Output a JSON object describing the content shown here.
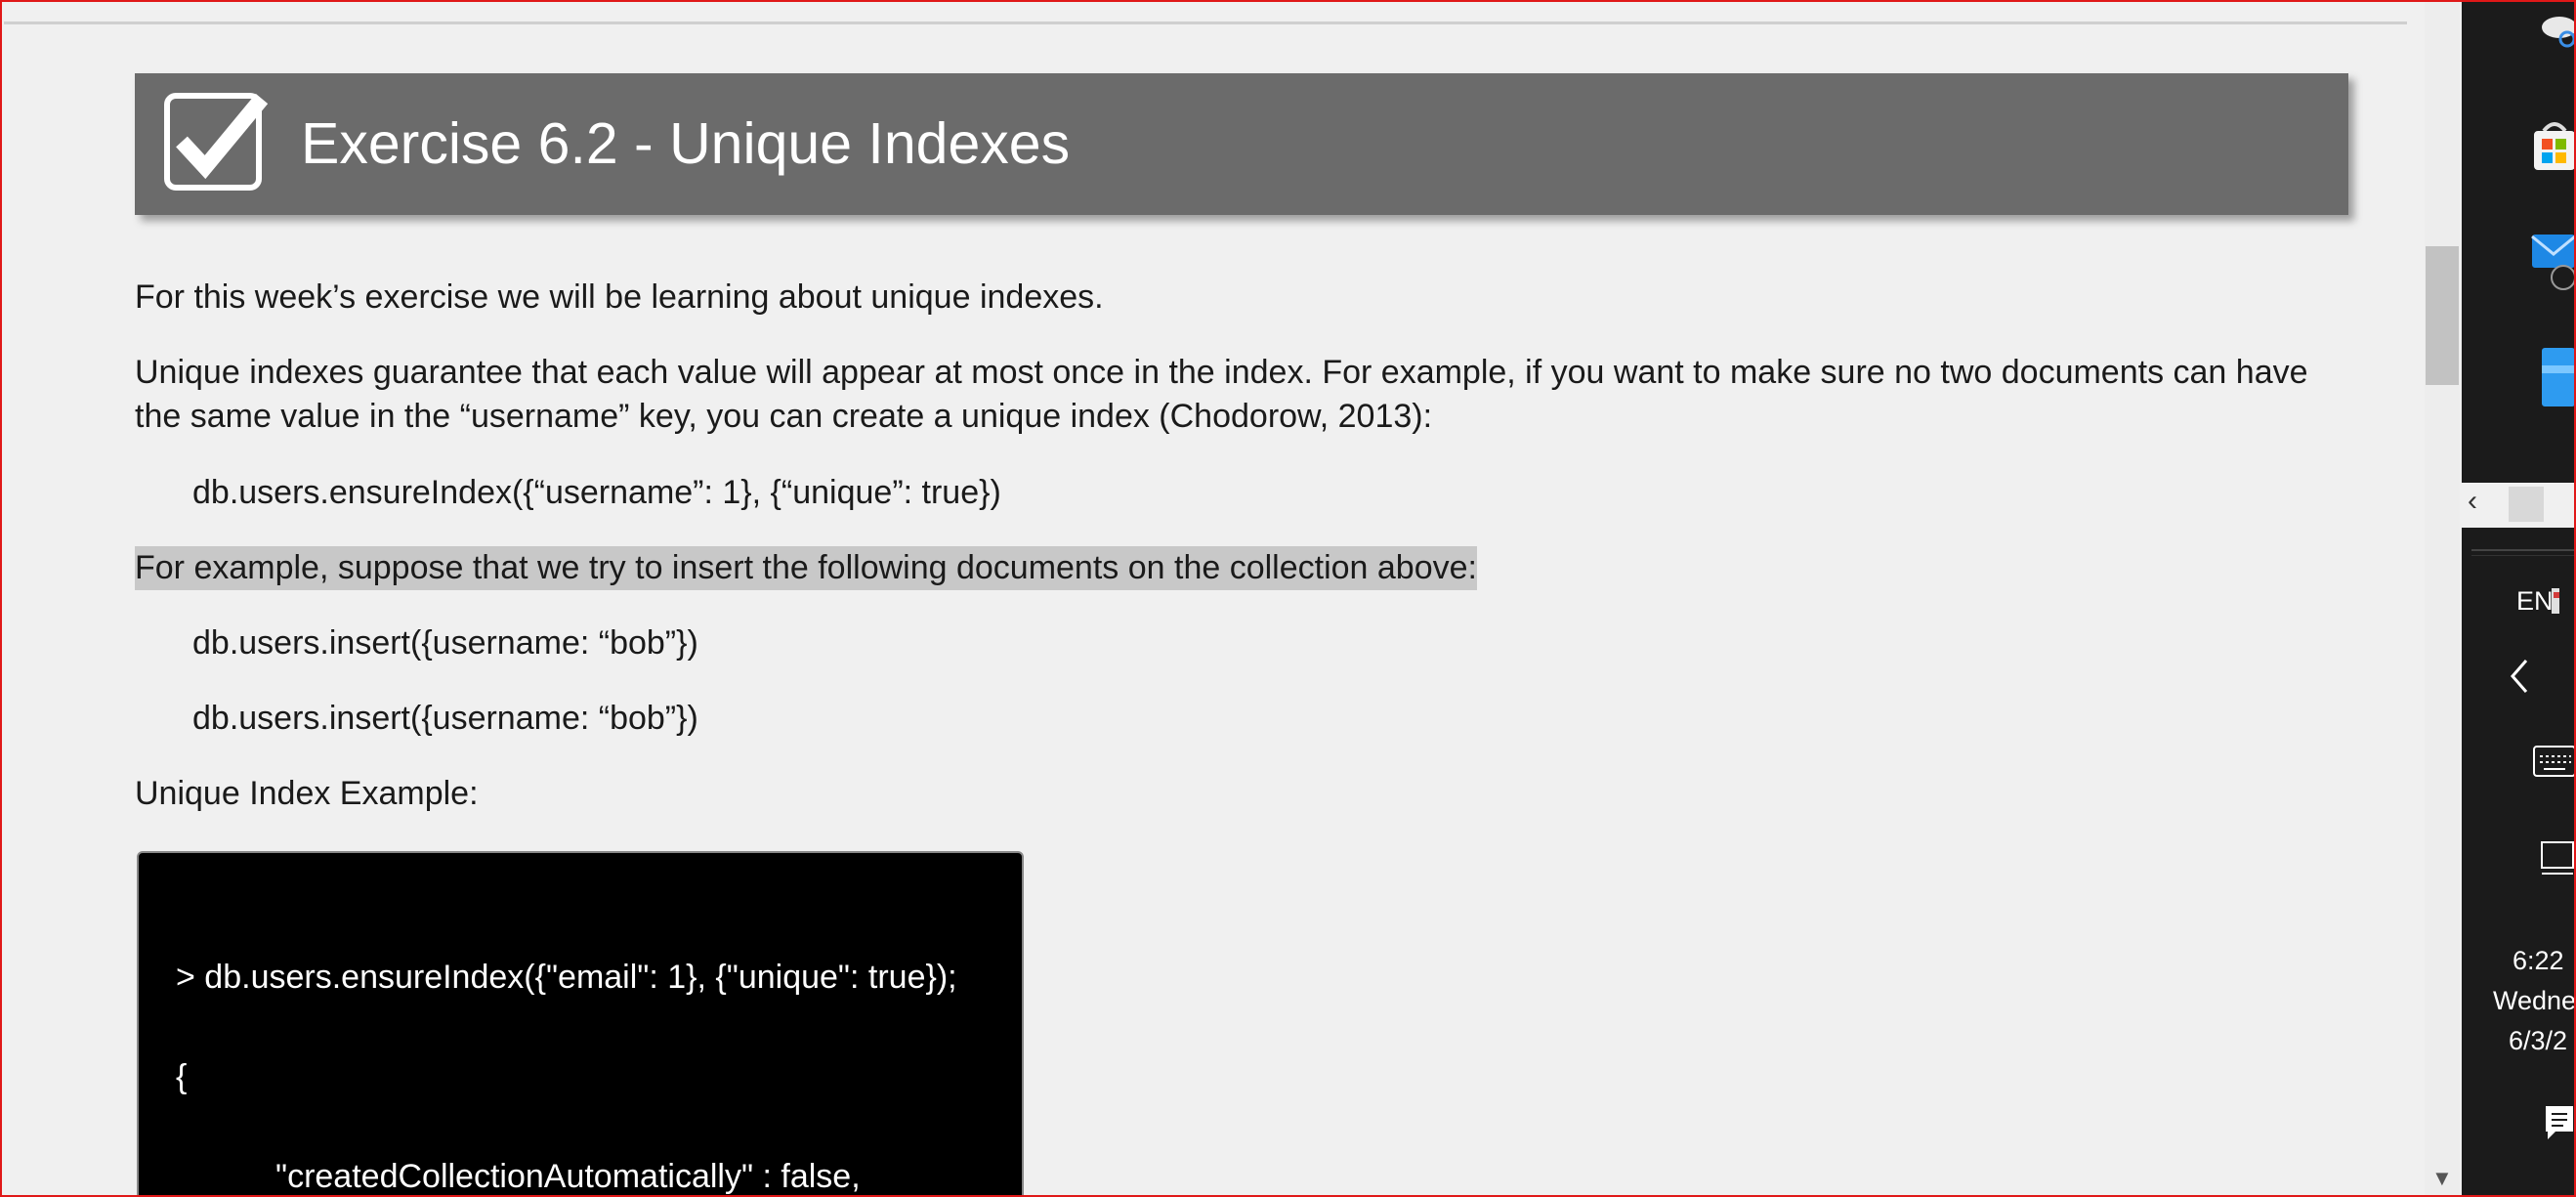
{
  "document": {
    "heading": "Exercise 6.2 - Unique Indexes",
    "paragraphs": {
      "intro": "For this week’s exercise we will be learning about unique indexes.",
      "definition": "Unique indexes guarantee that each value will appear at most once in the index. For example, if you want to make sure no two documents can have the same value in the “username” key, you can create a unique index (Chodorow, 2013):",
      "example_intro": "For example, suppose that we try to insert the following documents on the collection above:",
      "example_label": "Unique Index Example:"
    },
    "code": {
      "ensure_index": "db.users.ensureIndex({“username”: 1}, {“unique”: true})",
      "insert_1": "db.users.insert({username: “bob”})",
      "insert_2": "db.users.insert({username: “bob”})"
    },
    "console": {
      "line1": "> db.users.ensureIndex({\"email\": 1}, {\"unique\": true});",
      "line2": "{",
      "line3": "\"createdCollectionAutomatically\" : false,"
    },
    "highlight_color": "#c8c8c8",
    "banner_color": "#6b6b6b"
  },
  "taskbar": {
    "language": "EN",
    "time": "6:22",
    "day": "Wedne",
    "date": "6/3/2"
  }
}
